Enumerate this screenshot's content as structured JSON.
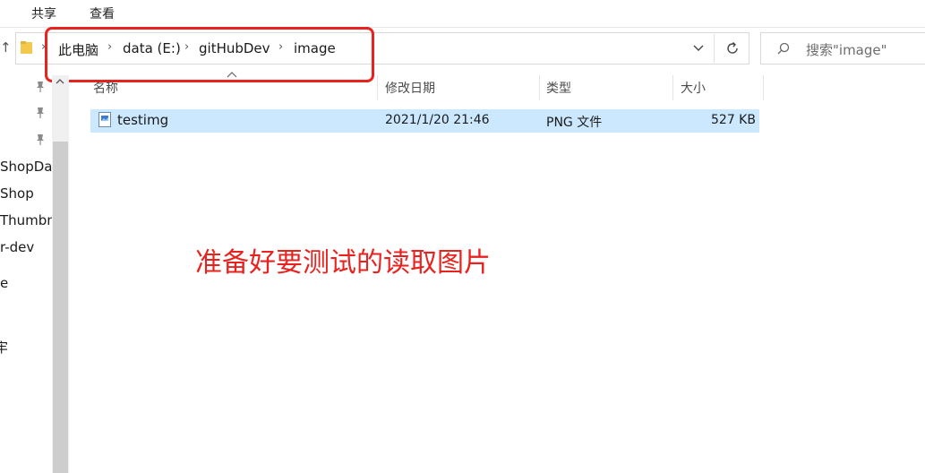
{
  "ribbon": {
    "tabs": [
      "共享",
      "查看"
    ]
  },
  "address_bar": {
    "breadcrumbs": [
      "此电脑",
      "data (E:)",
      "gitHubDev",
      "image"
    ]
  },
  "search": {
    "placeholder": "搜索\"image\""
  },
  "nav_pane": {
    "items": [
      "ShopDac",
      "Shop",
      "Thumbna",
      "r-dev",
      "e",
      "牢"
    ]
  },
  "file_list": {
    "columns": [
      "名称",
      "修改日期",
      "类型",
      "大小"
    ],
    "rows": [
      {
        "name": "testimg",
        "modified": "2021/1/20 21:46",
        "type": "PNG 文件",
        "size": "527 KB",
        "selected": true
      }
    ]
  },
  "annotation": {
    "text": "准备好要测试的读取图片"
  },
  "colors": {
    "highlight_box": "#e8231f",
    "selected_row": "#cce8ff"
  },
  "icons": [
    "folder-icon",
    "chevron-right-icon",
    "chevron-down-icon",
    "refresh-icon",
    "search-icon",
    "pin-icon",
    "image-file-icon",
    "up-arrow-icon"
  ]
}
